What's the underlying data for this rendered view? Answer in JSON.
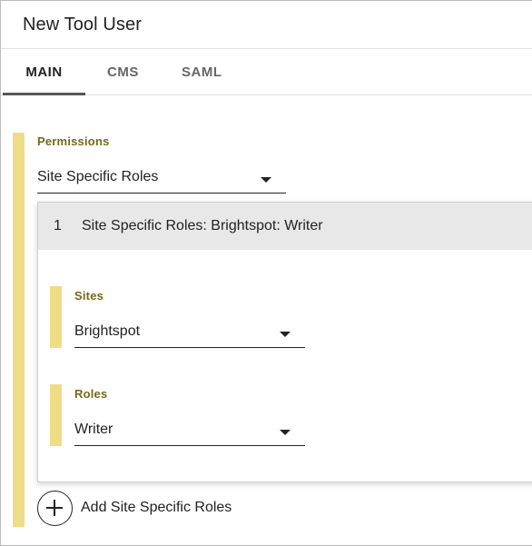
{
  "header": {
    "title": "New Tool User"
  },
  "tabs": [
    {
      "label": "MAIN",
      "active": true
    },
    {
      "label": "CMS",
      "active": false
    },
    {
      "label": "SAML",
      "active": false
    }
  ],
  "permissions": {
    "label": "Permissions",
    "selected": "Site Specific Roles"
  },
  "site_specific_roles": {
    "items": [
      {
        "index": "1",
        "title": "Site Specific Roles: Brightspot: Writer",
        "sites": {
          "label": "Sites",
          "selected": "Brightspot"
        },
        "roles": {
          "label": "Roles",
          "selected": "Writer"
        }
      }
    ],
    "add_label": "Add Site Specific Roles"
  },
  "colors": {
    "accent_bar": "#efdc86",
    "label_text": "#7a6618",
    "panel_header_bg": "#e8e8e8"
  },
  "icons": {
    "dropdown": "caret-down-icon",
    "add": "plus-circle-icon"
  }
}
